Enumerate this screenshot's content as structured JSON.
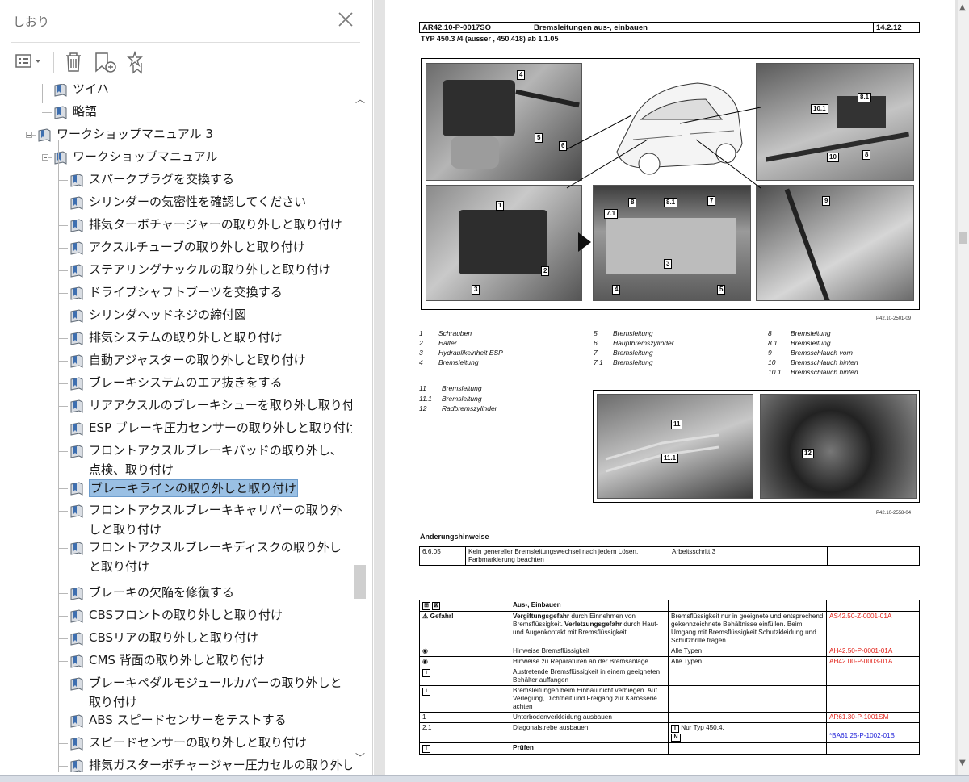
{
  "bookmarks_panel": {
    "title": "しおり",
    "toolbar": {
      "options_icon": "list-options-icon",
      "delete_icon": "trash-icon",
      "add_icon": "add-bookmark-icon",
      "find_icon": "find-bookmark-icon"
    },
    "items": [
      {
        "label": "ツイハ",
        "level": 2
      },
      {
        "label": "略語",
        "level": 2
      },
      {
        "label": "ワークショップマニュアル  3",
        "level": 1
      },
      {
        "label": "ワークショップマニュアル",
        "level": 2
      },
      {
        "label": "スパークプラグを交換する",
        "level": 3
      },
      {
        "label": "シリンダーの気密性を確認してください",
        "level": 3
      },
      {
        "label": "排気ターボチャージャーの取り外しと取り付け",
        "level": 3
      },
      {
        "label": "アクスルチューブの取り外しと取り付け",
        "level": 3
      },
      {
        "label": "ステアリングナックルの取り外しと取り付け",
        "level": 3
      },
      {
        "label": "ドライブシャフトブーツを交換する",
        "level": 3
      },
      {
        "label": "シリンダヘッドネジの締付図",
        "level": 3
      },
      {
        "label": "排気システムの取り外しと取り付け",
        "level": 3
      },
      {
        "label": "自動アジャスターの取り外しと取り付け",
        "level": 3
      },
      {
        "label": "ブレーキシステムのエア抜きをする",
        "level": 3
      },
      {
        "label": "リアアクスルのブレーキシューを取り外し取り付け",
        "level": 3
      },
      {
        "label": "ESP ブレーキ圧力センサーの取り外しと取り付け",
        "level": 3
      },
      {
        "label": "フロントアクスルブレーキパッドの取り外し、点検、取り付け",
        "level": 3
      },
      {
        "label": "ブレーキラインの取り外しと取り付け",
        "level": 3,
        "selected": true
      },
      {
        "label": "フロントアクスルブレーキキャリパーの取り外しと取り付け",
        "level": 3
      },
      {
        "label": "フロントアクスルブレーキディスクの取り外しと取り付け",
        "level": 3
      },
      {
        "label": "ブレーキの欠陥を修復する",
        "level": 3
      },
      {
        "label": "CBSフロントの取り外しと取り付け",
        "level": 3
      },
      {
        "label": "CBSリアの取り外しと取り付け",
        "level": 3
      },
      {
        "label": "CMS 背面の取り外しと取り付け",
        "level": 3
      },
      {
        "label": "ブレーキペダルモジュールカバーの取り外しと取り付け",
        "level": 3
      },
      {
        "label": "ABS スピードセンサーをテストする",
        "level": 3
      },
      {
        "label": "スピードセンサーの取り外しと取り付け",
        "level": 3
      },
      {
        "label": "排気ガスターボチャージャー圧力セルの取り外しと",
        "level": 3
      }
    ]
  },
  "document": {
    "header": {
      "code": "AR42.10-P-0017SO",
      "title": "Bremsleitungen aus-, einbauen",
      "date": "14.2.12"
    },
    "type_line": "TYP  450.3 /4 (ausser , 450.418) ab 1.1.05",
    "figure1_ref": "P42.10-2501-09",
    "figure2_ref": "P42.10-2558-04",
    "callouts_fig1": [
      "4",
      "5",
      "6",
      "10.1",
      "8.1",
      "10",
      "8",
      "1",
      "2",
      "3",
      "8",
      "8.1",
      "7",
      "7.1",
      "3",
      "4",
      "5",
      "9"
    ],
    "callouts_fig2": [
      "11",
      "11.1",
      "12"
    ],
    "legend1": [
      [
        {
          "n": "1",
          "t": "Schrauben"
        },
        {
          "n": "2",
          "t": "Halter"
        },
        {
          "n": "3",
          "t": "Hydraulikeinheit ESP"
        },
        {
          "n": "4",
          "t": "Bremsleitung"
        }
      ],
      [
        {
          "n": "5",
          "t": "Bremsleitung"
        },
        {
          "n": "6",
          "t": "Hauptbremszylinder"
        },
        {
          "n": "7",
          "t": "Bremsleitung"
        },
        {
          "n": "7.1",
          "t": "Bremsleitung"
        }
      ],
      [
        {
          "n": "8",
          "t": "Bremsleitung"
        },
        {
          "n": "8.1",
          "t": "Bremsleitung"
        },
        {
          "n": "9",
          "t": "Bremsschlauch vorn"
        },
        {
          "n": "10",
          "t": "Bremsschlauch hinten"
        },
        {
          "n": "10.1",
          "t": "Bremsschlauch hinten"
        }
      ]
    ],
    "legend2": [
      {
        "n": "11",
        "t": "Bremsleitung"
      },
      {
        "n": "11.1",
        "t": "Bremsleitung"
      },
      {
        "n": "12",
        "t": "Radbremszylinder"
      }
    ],
    "changes_title": "Änderungshinweise",
    "changes_row": {
      "date": "6.6.05",
      "text": "Kein genereller Bremsleitungswechsel nach jedem Lösen, Farbmarkierung beachten",
      "step": "Arbeitsschritt 3",
      "extra": ""
    },
    "steps_header": "Aus-, Einbauen",
    "steps": [
      {
        "c1": "Gefahr!",
        "c2a": "Vergiftungsgefahr",
        "c2b": " durch Einnehmen von Bremsflüssigkeit. ",
        "c2c": "Verletzungsgefahr",
        "c2d": " durch Haut- und Augenkontakt mit Bremsflüssigkeit",
        "c3": "Bremsflüssigkeit nur in geeignete und entsprechend gekennzeichnete Behältnisse einfüllen. Beim Umgang mit Bremsflüssigkeit Schutzkleidung und Schutzbrille tragen.",
        "c4": "AS42.50-Z-0001-01A"
      },
      {
        "c1": "",
        "c2": "Hinweise Bremsflüssigkeit",
        "c3": "Alle Typen",
        "c4": "AH42.50-P-0001-01A"
      },
      {
        "c1": "",
        "c2": "Hinweise zu Reparaturen an der Bremsanlage",
        "c3": "Alle Typen",
        "c4": "AH42.00-P-0003-01A"
      },
      {
        "c1": "",
        "c2": "Austretende Bremsflüssigkeit in einem geeigneten Behälter auffangen",
        "c3": "",
        "c4": ""
      },
      {
        "c1": "",
        "c2": "Bremsleitungen beim Einbau nicht verbiegen. Auf Verlegung, Dichtheit und Freigang zur Karosserie achten",
        "c3": "",
        "c4": ""
      },
      {
        "c1": "1",
        "c2": "Unterbodenverkleidung ausbauen",
        "c3": "",
        "c4": "AR61.30-P-1001SM"
      },
      {
        "c1": "2.1",
        "c2": "Diagonalstrebe ausbauen",
        "c3": "Nur Typ 450.4.",
        "c4": "*BA61.25-P-1002-01B"
      },
      {
        "c1": "",
        "c2": "Prüfen",
        "c3": "",
        "c4": ""
      }
    ]
  }
}
